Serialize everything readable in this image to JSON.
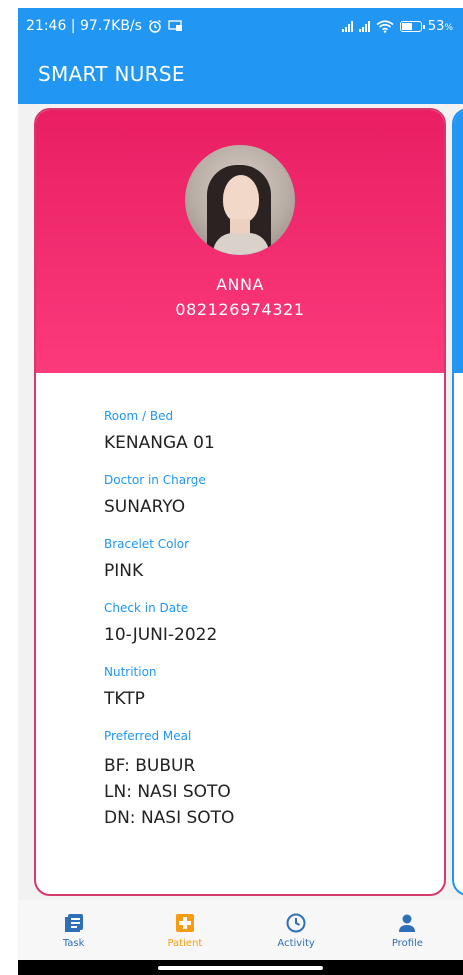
{
  "status_bar": {
    "time_speed": "21:46 | 97.7KB/s",
    "battery": "53",
    "battery_unit": "%"
  },
  "app_bar": {
    "title": "SMART NURSE"
  },
  "patient": {
    "name": "ANNA",
    "phone": "082126974321",
    "fields": [
      {
        "label": "Room  / Bed",
        "value": "KENANGA 01"
      },
      {
        "label": "Doctor in Charge",
        "value": "SUNARYO"
      },
      {
        "label": "Bracelet Color",
        "value": "PINK"
      },
      {
        "label": "Check in Date",
        "value": "10-JUNI-2022"
      },
      {
        "label": "Nutrition",
        "value": "TKTP"
      }
    ],
    "meal": {
      "label": "Preferred Meal",
      "lines": [
        "BF: BUBUR",
        "LN: NASI SOTO",
        "DN: NASI SOTO"
      ]
    }
  },
  "bottom_nav": {
    "items": [
      {
        "label": "Task",
        "icon": "task-list-icon",
        "active": false
      },
      {
        "label": "Patient",
        "icon": "patient-cross-icon",
        "active": true
      },
      {
        "label": "Activity",
        "icon": "clock-icon",
        "active": false
      },
      {
        "label": "Profile",
        "icon": "person-icon",
        "active": false
      }
    ]
  },
  "colors": {
    "primary": "#2196f3",
    "card_header": "#e91e63",
    "card_border": "#d63a6b",
    "active_nav": "#f59c12"
  }
}
